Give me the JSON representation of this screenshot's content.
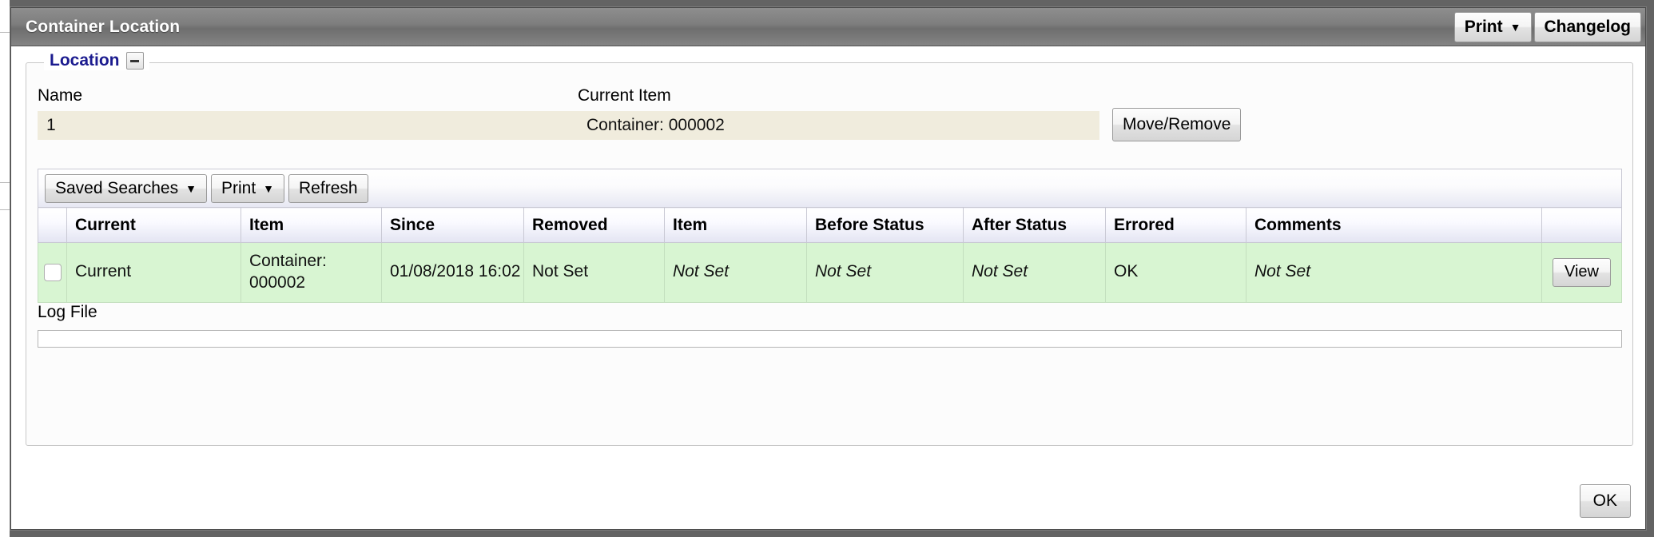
{
  "window": {
    "title": "Container Location",
    "titlebar_buttons": [
      {
        "label": "Print",
        "caret": "▼",
        "icon": "caret-down-icon"
      },
      {
        "label": "Changelog",
        "caret": "",
        "icon": ""
      }
    ]
  },
  "location_group": {
    "legend": "Location",
    "collapse_icon": "minus-icon",
    "fields": {
      "name": {
        "label": "Name",
        "value": "1"
      },
      "current_item": {
        "label": "Current Item",
        "value": "Container: 000002"
      }
    },
    "move_remove_button": "Move/Remove"
  },
  "grid": {
    "toolbar": [
      {
        "label": "Saved Searches",
        "caret": "▼",
        "icon": "caret-down-icon"
      },
      {
        "label": "Print",
        "caret": "▼",
        "icon": "caret-down-icon"
      },
      {
        "label": "Refresh",
        "caret": "",
        "icon": ""
      }
    ],
    "columns": [
      "",
      "Current",
      "Item",
      "Since",
      "Removed",
      "Item",
      "Before Status",
      "After Status",
      "Errored",
      "Comments",
      ""
    ],
    "rows": [
      {
        "selected": false,
        "current": "Current",
        "item_current": "Container: 000002",
        "since": "01/08/2018 16:02",
        "removed": "Not Set",
        "item_removed": "Not Set",
        "before_status": "Not Set",
        "after_status": "Not Set",
        "errored": "OK",
        "comments": "Not Set",
        "action": "View"
      }
    ]
  },
  "log_file": {
    "label": "Log File",
    "value": "",
    "placeholder": ""
  },
  "footer": {
    "ok_label": "OK"
  },
  "colors": {
    "titlebar": "#7e7e7e",
    "legend_text": "#1b1b8f",
    "readonly_field_bg": "#f0ecdd",
    "row_bg": "#d8f5d2",
    "header_bg": "#e3e4f2"
  }
}
